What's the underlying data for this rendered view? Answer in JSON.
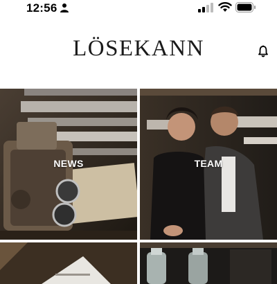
{
  "status_bar": {
    "time": "12:56",
    "icons": [
      "person-icon",
      "signal-icon",
      "wifi-icon",
      "battery-icon"
    ]
  },
  "header": {
    "logo_text": "LÖSEKANN",
    "notification_icon": "bell-icon"
  },
  "tiles": [
    {
      "label": "NEWS"
    },
    {
      "label": "TEAM"
    },
    {
      "label": ""
    },
    {
      "label": ""
    }
  ],
  "colors": {
    "background": "#ffffff",
    "text": "#1a1a1a",
    "tile_label": "#ffffff"
  }
}
